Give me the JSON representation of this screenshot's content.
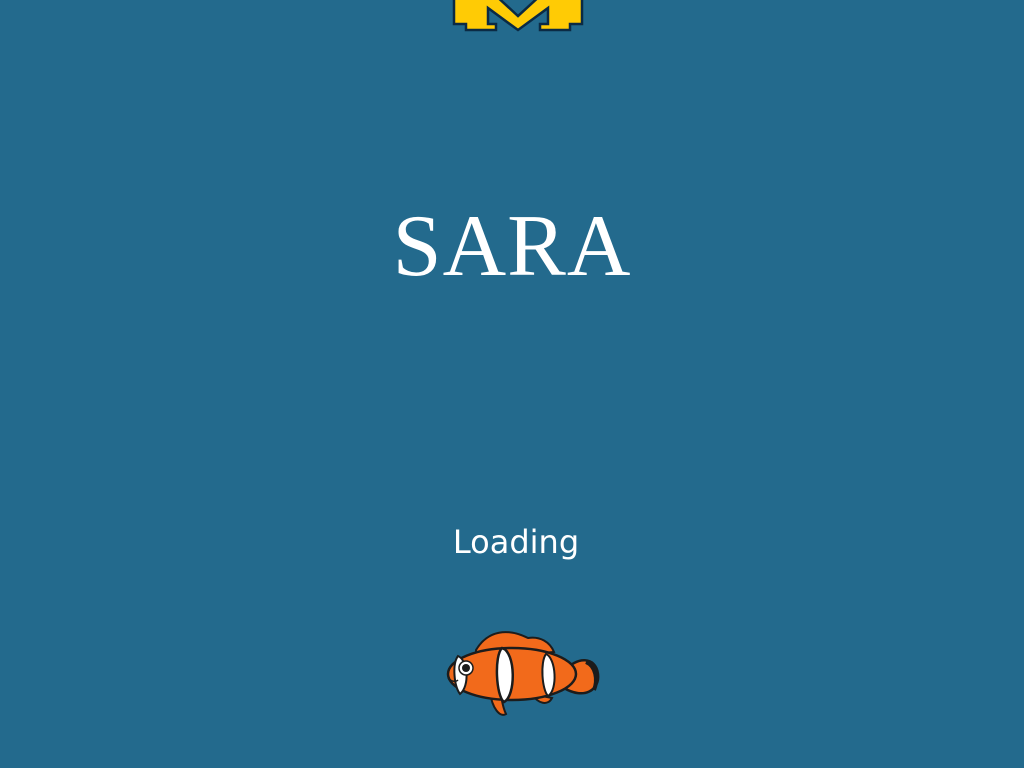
{
  "app": {
    "title": "SARA",
    "status": "Loading",
    "logo": "block-m-logo",
    "mascot": "clownfish-icon"
  },
  "colors": {
    "background": "#236a8d",
    "text": "#ffffff",
    "logo_fill": "#ffcb05",
    "logo_outline": "#0b2a44",
    "fish_orange": "#f26a1b",
    "fish_stripe": "#ffffff"
  }
}
